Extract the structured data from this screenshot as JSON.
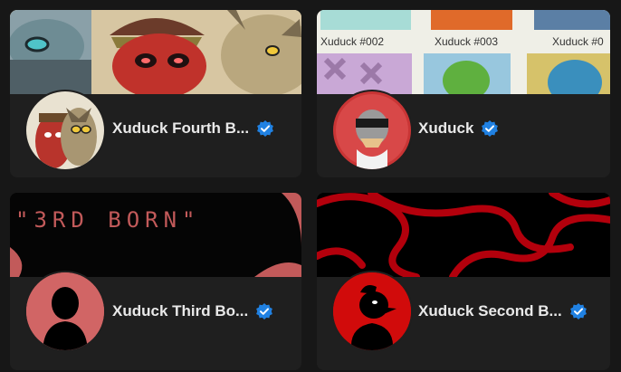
{
  "collections": [
    {
      "name": "Xuduck Fourth B...",
      "verified": true,
      "banner_text": []
    },
    {
      "name": "Xuduck",
      "verified": true,
      "banner_text": [
        "Xuduck #002",
        "Xuduck #003",
        "Xuduck #0"
      ]
    },
    {
      "name": "Xuduck Third Bo...",
      "verified": true,
      "banner_text": [
        "\"3RD BORN\""
      ]
    },
    {
      "name": "Xuduck Second B...",
      "verified": true,
      "banner_text": []
    }
  ],
  "colors": {
    "background": "#171717",
    "card": "#1f1f1f",
    "verified_badge": "#2081e2",
    "third_banner_accent": "#c25a5a",
    "second_banner_red": "#b3000c"
  },
  "icons": {
    "verified": "verified-badge-icon",
    "silhouette": "profile-silhouette-icon"
  }
}
